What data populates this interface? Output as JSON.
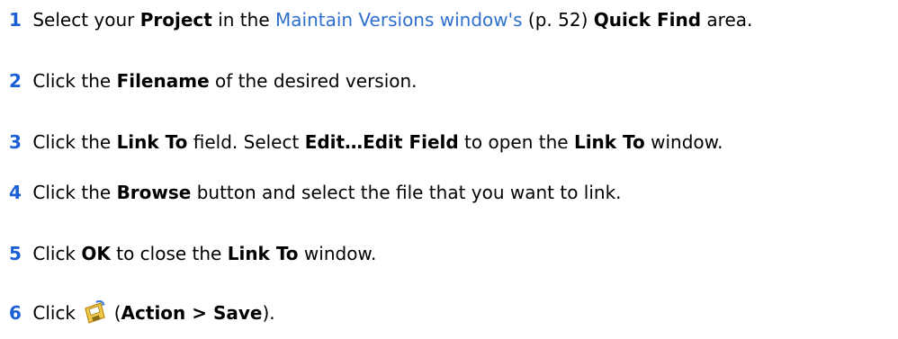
{
  "steps": [
    {
      "num": "1",
      "t1": "Select your ",
      "b1": "Project",
      "t2": " in the ",
      "link": "Maintain Versions window's",
      "t3": " (p. 52) ",
      "b2": "Quick Find",
      "t4": " area."
    },
    {
      "num": "2",
      "t1": "Click the ",
      "b1": "Filename",
      "t2": " of the desired version."
    },
    {
      "num": "3",
      "t1": "Click the ",
      "b1": "Link To",
      "t2": " field.  Select ",
      "b2": "Edit…Edit Field",
      "t3": " to open the ",
      "b3": "Link To",
      "t4": " window."
    },
    {
      "num": "4",
      "t1": "Click the ",
      "b1": "Browse",
      "t2": " button and select the file that you want to link."
    },
    {
      "num": "5",
      "t1": "Click ",
      "b1": "OK",
      "t2": " to close the ",
      "b2": "Link To",
      "t3": " window."
    },
    {
      "num": "6",
      "t1": "Click ",
      "icon": "save-floppy-icon",
      "t2": " (",
      "b1": "Action > Save",
      "t3": ")."
    }
  ],
  "colors": {
    "step_number": "#1a5fd6",
    "link": "#2f6fce",
    "text": "#000000"
  }
}
